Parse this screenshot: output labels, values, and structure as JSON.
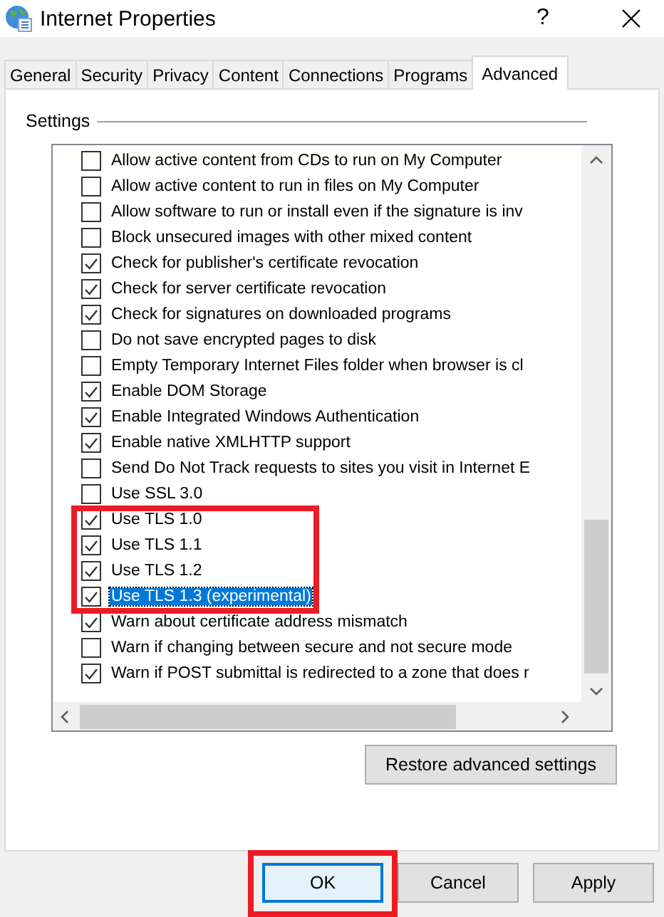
{
  "window": {
    "title": "Internet Properties",
    "help": "?"
  },
  "tabs": [
    {
      "label": "General",
      "selected": false
    },
    {
      "label": "Security",
      "selected": false
    },
    {
      "label": "Privacy",
      "selected": false
    },
    {
      "label": "Content",
      "selected": false
    },
    {
      "label": "Connections",
      "selected": false
    },
    {
      "label": "Programs",
      "selected": false
    },
    {
      "label": "Advanced",
      "selected": true
    }
  ],
  "settings": {
    "label": "Settings",
    "items": [
      {
        "label": "Allow active content from CDs to run on My Computer",
        "checked": false,
        "selected": false,
        "highlighted": false
      },
      {
        "label": "Allow active content to run in files on My Computer",
        "checked": false,
        "selected": false,
        "highlighted": false
      },
      {
        "label": "Allow software to run or install even if the signature is inv",
        "checked": false,
        "selected": false,
        "highlighted": false
      },
      {
        "label": "Block unsecured images with other mixed content",
        "checked": false,
        "selected": false,
        "highlighted": false
      },
      {
        "label": "Check for publisher's certificate revocation",
        "checked": true,
        "selected": false,
        "highlighted": false
      },
      {
        "label": "Check for server certificate revocation",
        "checked": true,
        "selected": false,
        "highlighted": false
      },
      {
        "label": "Check for signatures on downloaded programs",
        "checked": true,
        "selected": false,
        "highlighted": false
      },
      {
        "label": "Do not save encrypted pages to disk",
        "checked": false,
        "selected": false,
        "highlighted": false
      },
      {
        "label": "Empty Temporary Internet Files folder when browser is cl",
        "checked": false,
        "selected": false,
        "highlighted": false
      },
      {
        "label": "Enable DOM Storage",
        "checked": true,
        "selected": false,
        "highlighted": false
      },
      {
        "label": "Enable Integrated Windows Authentication",
        "checked": true,
        "selected": false,
        "highlighted": false
      },
      {
        "label": "Enable native XMLHTTP support",
        "checked": true,
        "selected": false,
        "highlighted": false
      },
      {
        "label": "Send Do Not Track requests to sites you visit in Internet E",
        "checked": false,
        "selected": false,
        "highlighted": false
      },
      {
        "label": "Use SSL 3.0",
        "checked": false,
        "selected": false,
        "highlighted": false
      },
      {
        "label": "Use TLS 1.0",
        "checked": true,
        "selected": false,
        "highlighted": true
      },
      {
        "label": "Use TLS 1.1",
        "checked": true,
        "selected": false,
        "highlighted": true
      },
      {
        "label": "Use TLS 1.2",
        "checked": true,
        "selected": false,
        "highlighted": true
      },
      {
        "label": "Use TLS 1.3 (experimental)",
        "checked": true,
        "selected": true,
        "highlighted": true
      },
      {
        "label": "Warn about certificate address mismatch",
        "checked": true,
        "selected": false,
        "highlighted": false
      },
      {
        "label": "Warn if changing between secure and not secure mode",
        "checked": false,
        "selected": false,
        "highlighted": false
      },
      {
        "label": "Warn if POST submittal is redirected to a zone that does r",
        "checked": true,
        "selected": false,
        "highlighted": false
      }
    ]
  },
  "restore_button": "Restore advanced settings",
  "buttons": [
    {
      "label": "OK",
      "default": true,
      "highlighted": true
    },
    {
      "label": "Cancel",
      "default": false,
      "highlighted": false
    },
    {
      "label": "Apply",
      "default": false,
      "highlighted": false
    }
  ]
}
